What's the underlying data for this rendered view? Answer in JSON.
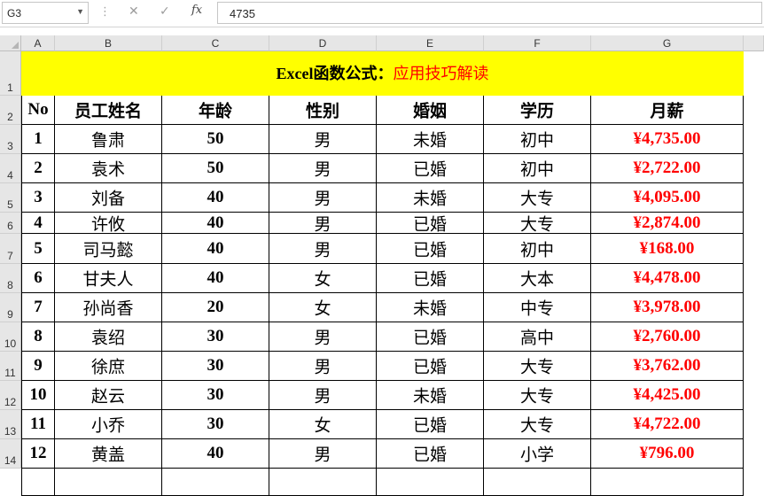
{
  "formula_bar": {
    "name_box": "G3",
    "content": "4735",
    "cancel_icon": "close-icon",
    "enter_icon": "check-icon",
    "function_label": "fx"
  },
  "columns": [
    "A",
    "B",
    "C",
    "D",
    "E",
    "F",
    "G"
  ],
  "rows": [
    "1",
    "2",
    "3",
    "4",
    "5",
    "6",
    "7",
    "8",
    "9",
    "10",
    "11",
    "12",
    "13",
    "14"
  ],
  "sheet": {
    "title_part1": "Excel函数公式：",
    "title_part2": "应用技巧解读",
    "headers": [
      "No",
      "员工姓名",
      "年龄",
      "性别",
      "婚姻",
      "学历",
      "月薪"
    ],
    "data": [
      [
        "1",
        "鲁肃",
        "50",
        "男",
        "未婚",
        "初中",
        "¥4,735.00"
      ],
      [
        "2",
        "袁术",
        "50",
        "男",
        "已婚",
        "初中",
        "¥2,722.00"
      ],
      [
        "3",
        "刘备",
        "40",
        "男",
        "未婚",
        "大专",
        "¥4,095.00"
      ],
      [
        "4",
        "许攸",
        "40",
        "男",
        "已婚",
        "大专",
        "¥2,874.00"
      ],
      [
        "5",
        "司马懿",
        "40",
        "男",
        "已婚",
        "初中",
        "¥168.00"
      ],
      [
        "6",
        "甘夫人",
        "40",
        "女",
        "已婚",
        "大本",
        "¥4,478.00"
      ],
      [
        "7",
        "孙尚香",
        "20",
        "女",
        "未婚",
        "中专",
        "¥3,978.00"
      ],
      [
        "8",
        "袁绍",
        "30",
        "男",
        "已婚",
        "高中",
        "¥2,760.00"
      ],
      [
        "9",
        "徐庶",
        "30",
        "男",
        "已婚",
        "大专",
        "¥3,762.00"
      ],
      [
        "10",
        "赵云",
        "30",
        "男",
        "未婚",
        "大专",
        "¥4,425.00"
      ],
      [
        "11",
        "小乔",
        "30",
        "女",
        "已婚",
        "大专",
        "¥4,722.00"
      ],
      [
        "12",
        "黄盖",
        "40",
        "男",
        "已婚",
        "小学",
        "¥796.00"
      ]
    ]
  },
  "colors": {
    "title_bg": "#ffff00",
    "salary_red": "#ff0000",
    "header_gray": "#e6e6e6"
  }
}
